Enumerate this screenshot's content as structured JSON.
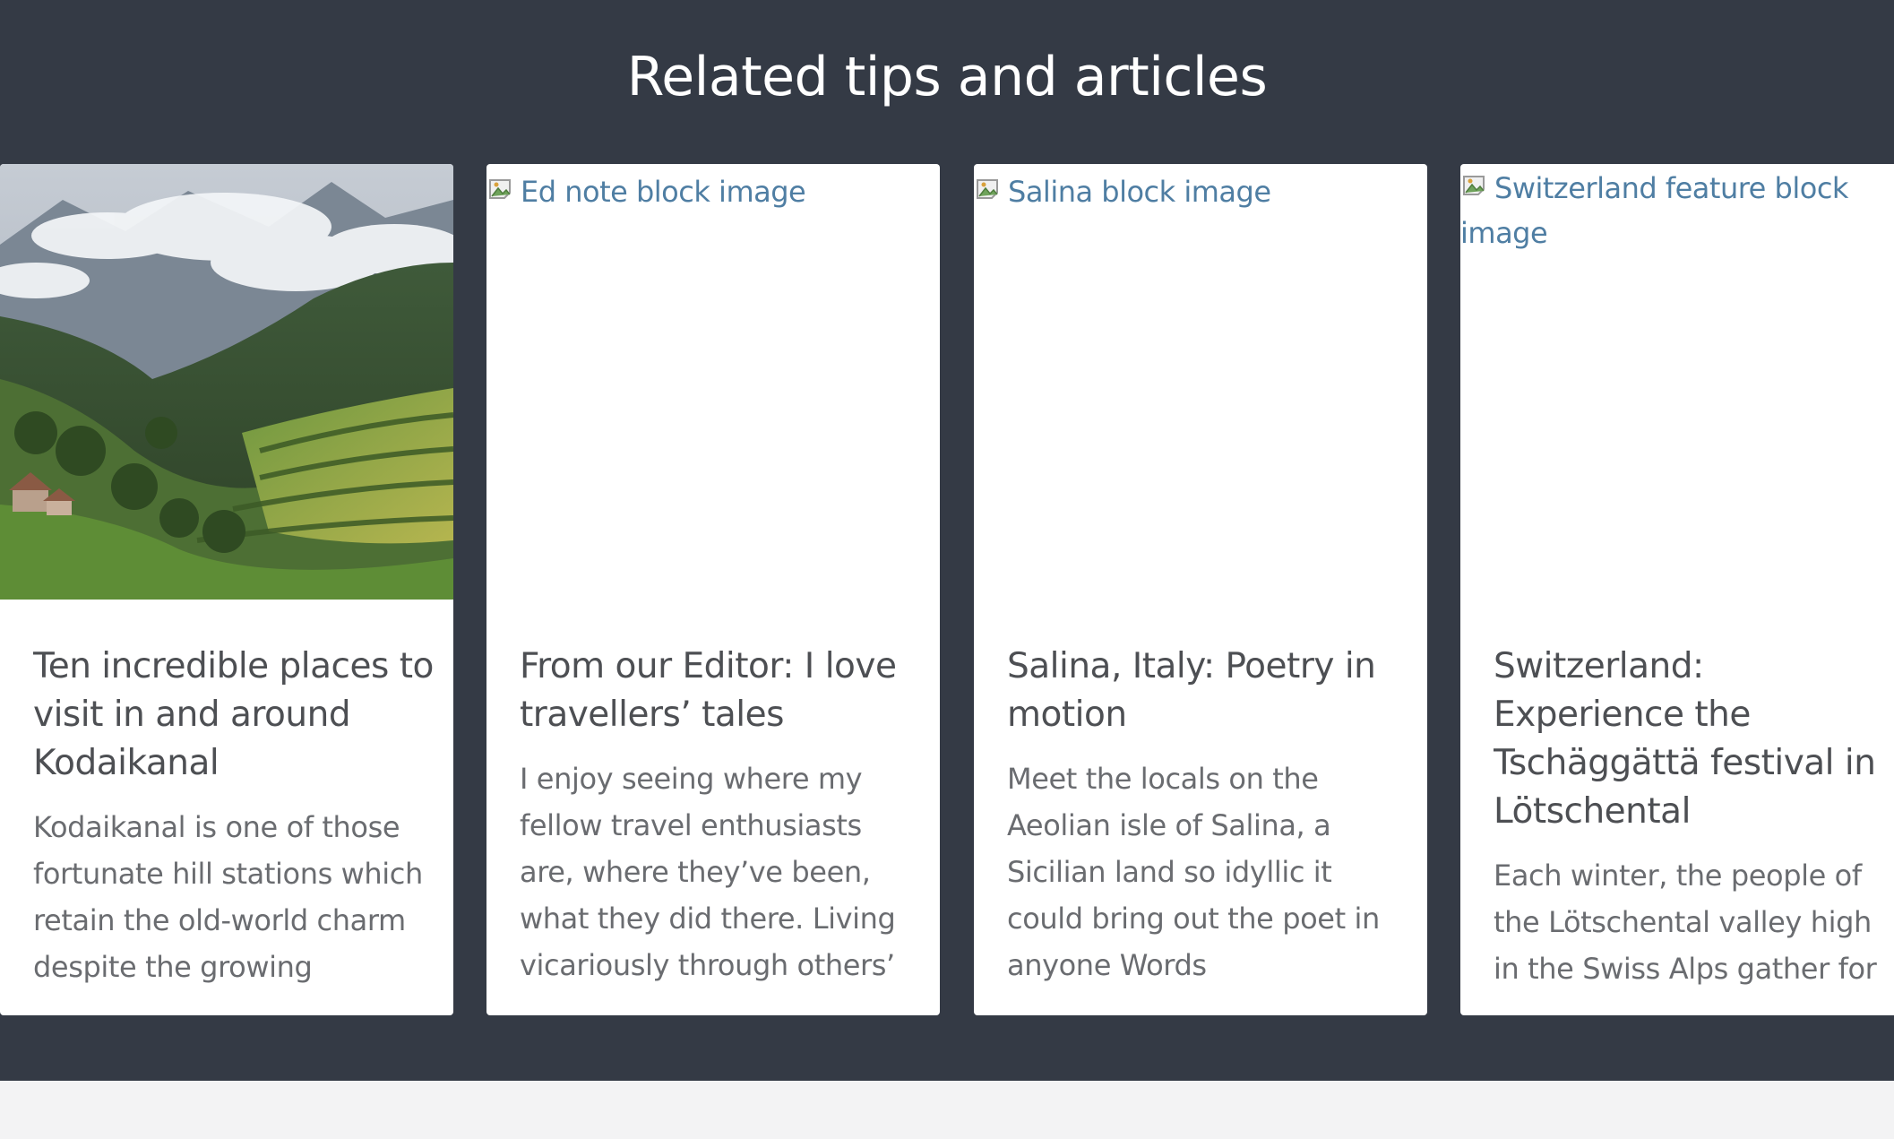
{
  "section": {
    "title": "Related tips and articles"
  },
  "cards": [
    {
      "image_alt": "",
      "title": "Ten incredible places to visit in and around Kodaikanal",
      "summary": "Kodaikanal is one of those fortunate hill stations which retain the old-world charm despite the growing"
    },
    {
      "image_alt": "Ed note block image",
      "title": "From our Editor: I love travellers’ tales",
      "summary": "I enjoy seeing where my fellow travel enthusiasts are, where they’ve been, what they did there. Living vicariously through others’"
    },
    {
      "image_alt": "Salina block image",
      "title": "Salina, Italy: Poetry in motion",
      "summary": "Meet the locals on the Aeolian isle of Salina, a Sicilian land so idyllic it could bring out the poet in anyone Words"
    },
    {
      "image_alt": "Switzerland feature block image",
      "title": "Switzerland: Experience the Tschäggättä festival in Lötschental",
      "summary": "Each winter, the people of the Lötschental valley high in the Swiss Alps gather for"
    }
  ],
  "colors": {
    "section_background": "#343a45",
    "page_background": "#f3f3f4",
    "card_background": "#ffffff",
    "title_text": "#4d4f53",
    "summary_text": "#6a6c70",
    "broken_image_text": "#4f7ea3"
  },
  "icons": {
    "broken_image": "broken-image-icon"
  }
}
